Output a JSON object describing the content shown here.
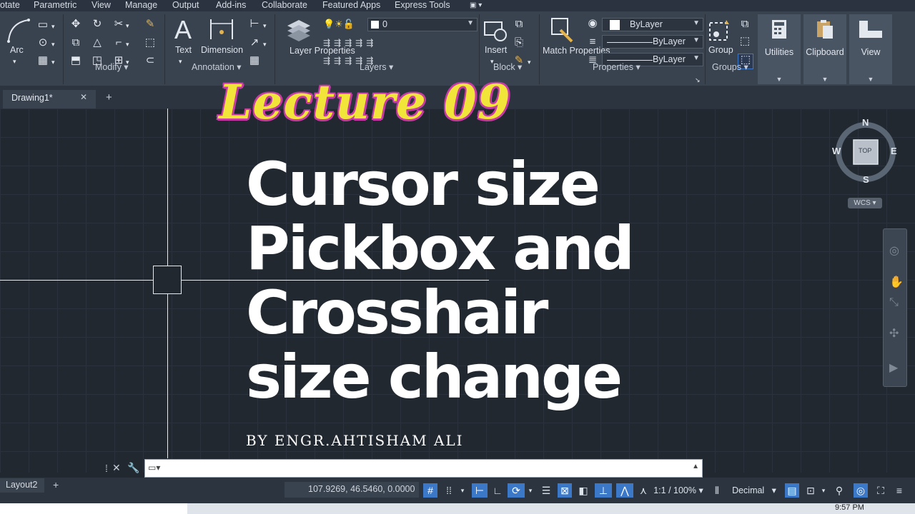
{
  "menu": {
    "items": [
      "otate",
      "Parametric",
      "View",
      "Manage",
      "Output",
      "Add-ins",
      "Collaborate",
      "Featured Apps",
      "Express Tools"
    ]
  },
  "ribbon": {
    "draw": {
      "arc_label": "Arc"
    },
    "modify": {
      "title": "Modify"
    },
    "annotation": {
      "title": "Annotation",
      "text_label": "Text",
      "dimension_label": "Dimension"
    },
    "layers": {
      "title": "Layers",
      "properties_label": "Layer Properties",
      "layer_value": "0"
    },
    "block": {
      "title": "Block",
      "insert_label": "Insert"
    },
    "properties": {
      "title": "Properties",
      "match_label": "Match Properties",
      "color_value": "ByLayer",
      "linetype_value": "ByLayer",
      "lineweight_value": "ByLayer"
    },
    "groups": {
      "title": "Groups",
      "group_label": "Group"
    },
    "utilities_label": "Utilities",
    "clipboard_label": "Clipboard",
    "view_label": "View"
  },
  "tabs": {
    "drawing_tab": "Drawing1*",
    "close_symbol": "✕",
    "add_symbol": "+"
  },
  "overlay": {
    "lecture_title": "Lecture 09",
    "headline_lines": [
      "Cursor size",
      "Pickbox and",
      "Crosshair",
      "size change"
    ],
    "byline": "BY ENGR.AHTISHAM ALI"
  },
  "viewcube": {
    "north": "N",
    "south": "S",
    "east": "E",
    "west": "W",
    "face": "TOP",
    "wcs_label": "WCS"
  },
  "statusbar": {
    "layout_tab": "Layout2",
    "add_layout": "+",
    "coordinates": "107.9269, 46.5460, 0.0000",
    "scale": "1:1 / 100%",
    "units": "Decimal"
  },
  "taskbar": {
    "clock": "9:57 PM"
  },
  "colors": {
    "accent": "#3c78c8",
    "lecture_yellow": "#f2e53a",
    "lecture_outline": "#c83aa5",
    "canvas_bg": "#212830"
  }
}
